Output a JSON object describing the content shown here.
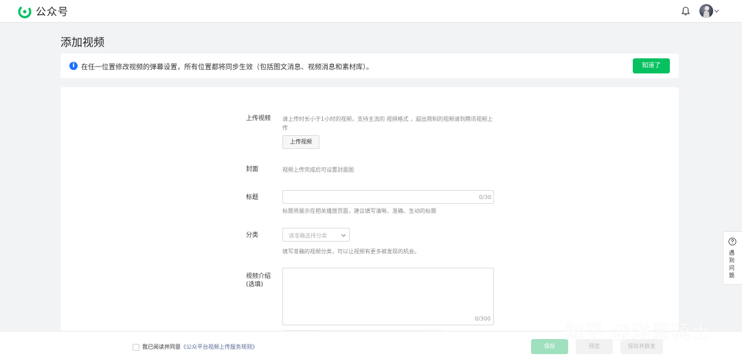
{
  "header": {
    "app_name": "公众号",
    "logo_icon": "wechat-official-account-logo",
    "bell_icon": "bell-icon",
    "avatar_icon": "avatar"
  },
  "page": {
    "title": "添加视频"
  },
  "notice": {
    "icon": "info-icon",
    "icon_glyph": "i",
    "text": "在任一位置修改视频的弹幕设置，所有位置都将同步生效（包括图文消息、视频消息和素材库）。",
    "button_label": "知道了",
    "accent_color": "#07c160"
  },
  "form": {
    "upload": {
      "label": "上传视频",
      "desc_line1": "请上传时长小于1小时的视频，支持主流的 视频格式 ，超出限制的视频请到腾讯视频上",
      "desc_line2": "传",
      "button_label": "上传视频"
    },
    "cover": {
      "label": "封面",
      "desc": "视频上传完成后可设置封面图"
    },
    "title": {
      "label": "标题",
      "value": "",
      "counter": "0/30",
      "hint": "标题将展示在相关播放页面，建议填写清晰、准确、生动的标题"
    },
    "category": {
      "label": "分类",
      "placeholder": "请准确选择分类",
      "hint": "填写准确的视频分类，可以让视频有更多被发现的机会。"
    },
    "intro": {
      "label_line1": "视频介绍",
      "label_line2": "(选填)",
      "value": "",
      "counter": "0/300"
    }
  },
  "footer": {
    "agree_prefix": "我已阅读并同意",
    "agree_link": "《公众平台视频上传服务规则》",
    "save_label": "保存",
    "preview_label": "预览",
    "save_send_label": "保存并群发"
  },
  "help": {
    "icon": "question-circle-icon",
    "text": "遇到问题"
  },
  "watermark": {
    "text": "知乎 @洋葱骑士"
  }
}
